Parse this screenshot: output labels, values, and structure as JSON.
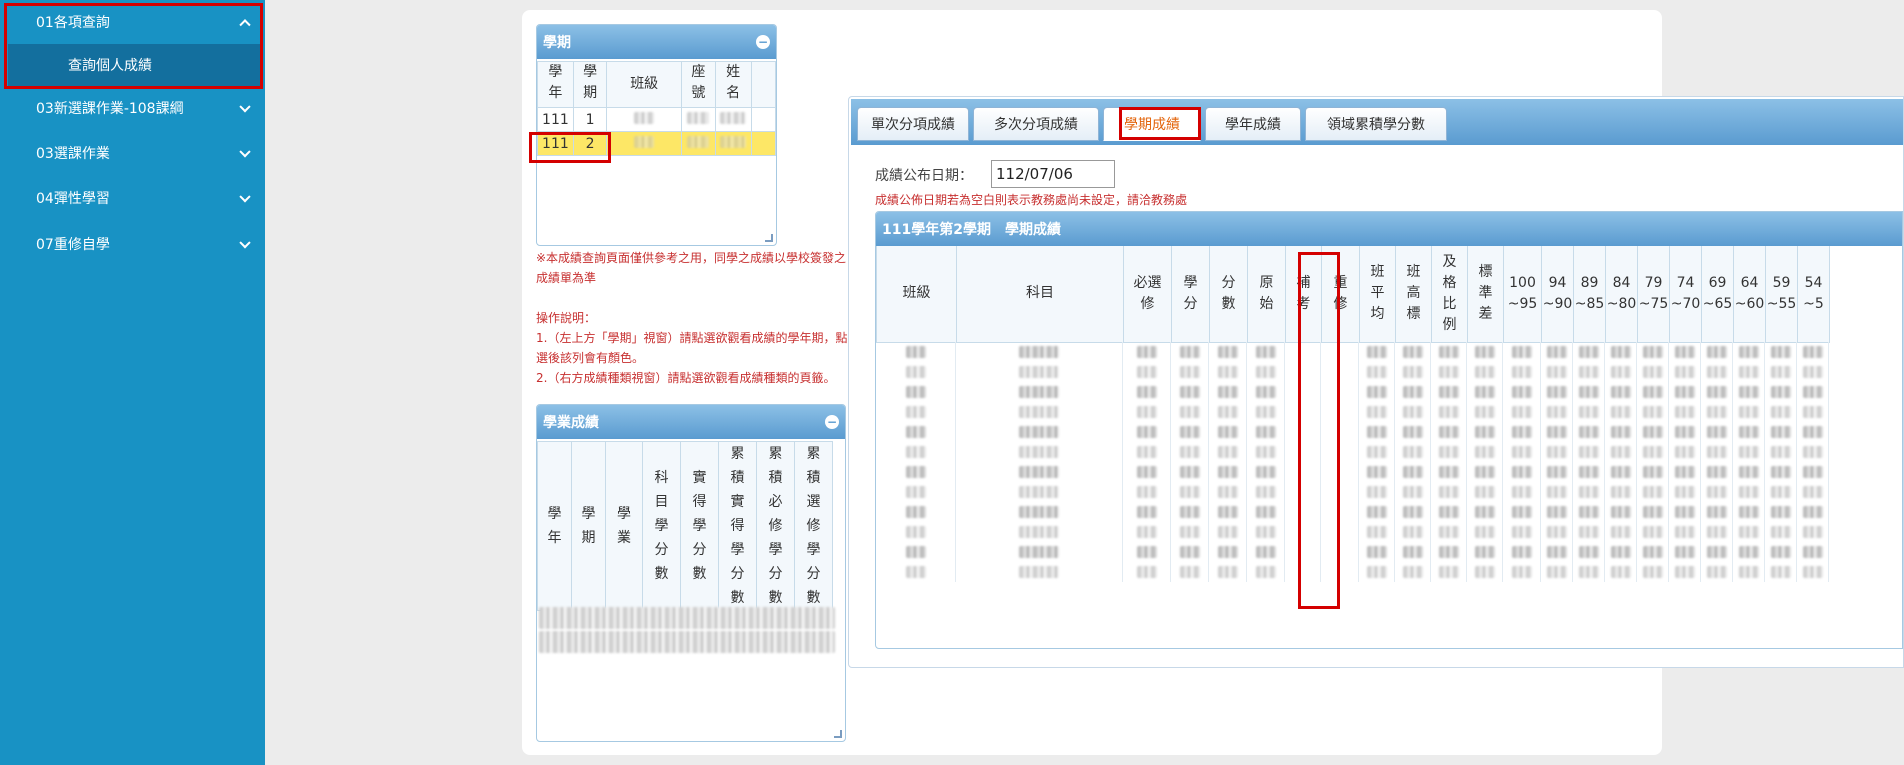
{
  "sidebar": {
    "items": [
      {
        "label": "01各項查詢",
        "icon": "chevron-up-icon"
      },
      {
        "label": "03新選課作業-108課綱",
        "icon": "chevron-down-icon"
      },
      {
        "label": "03選課作業",
        "icon": "chevron-down-icon"
      },
      {
        "label": "04彈性學習",
        "icon": "chevron-down-icon"
      },
      {
        "label": "07重修自學",
        "icon": "chevron-down-icon"
      }
    ],
    "sub_item": "查詢個人成績"
  },
  "semester_panel": {
    "title": "學期",
    "headers": [
      "學\n年",
      "學\n期",
      "班級",
      "座\n號",
      "姓\n名"
    ],
    "rows": [
      {
        "year": "111",
        "term": "1"
      },
      {
        "year": "111",
        "term": "2"
      }
    ]
  },
  "notes": {
    "warning": "※本成績查詢頁面僅供參考之用，同學之成績以學校簽發之成績單為準",
    "instructions_title": "操作說明：",
    "step1": "1.（左上方「學期」視窗）請點選欲觀看成績的學年期，點選後該列會有顏色。",
    "step2": "2.（右方成績種類視窗）請點選欲觀看成績種類的頁籤。"
  },
  "academic_panel": {
    "title": "學業成績",
    "headers": [
      "學\n年",
      "學\n期",
      "學\n業",
      "科\n目\n學\n分\n數",
      "實\n得\n學\n分\n數",
      "累\n積\n實\n得\n學\n分\n數",
      "累\n積\n必\n修\n學\n分\n數",
      "累\n積\n選\n修\n學\n分\n數"
    ]
  },
  "grades": {
    "tabs": [
      "單次分項成績",
      "多次分項成績",
      "學期成績",
      "學年成績",
      "領域累積學分數"
    ],
    "active_tab": "學期成績",
    "date_label": "成績公布日期：",
    "date_value": "112/07/06",
    "date_note": "成績公佈日期若為空白則表示教務處尚未設定，請洽教務處",
    "term_title": "111學年第2學期　學期成績",
    "columns": [
      "班級",
      "科目",
      "必選\n修",
      "學\n分",
      "分\n數",
      "原\n始",
      "補\n考",
      "重\n修",
      "班\n平\n均",
      "班\n高\n標",
      "及\n格\n比\n例",
      "標\n準\n差",
      "100\n~95",
      "94\n~90",
      "89\n~85",
      "84\n~80",
      "79\n~75",
      "74\n~70",
      "69\n~65",
      "64\n~60",
      "59\n~55",
      "54\n~5"
    ]
  }
}
